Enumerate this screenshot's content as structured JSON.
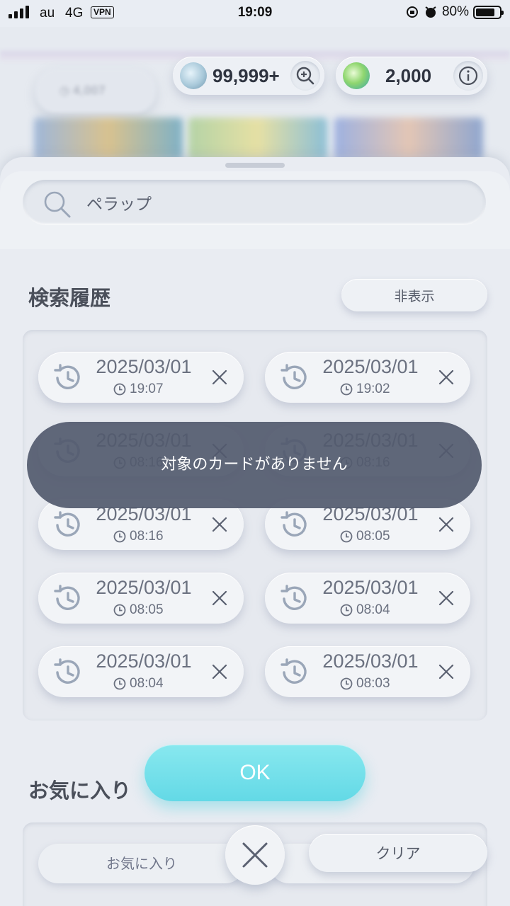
{
  "status_bar": {
    "carrier": "au",
    "network": "4G",
    "vpn": "VPN",
    "time": "19:09",
    "battery": "80%",
    "battery_level": 0.8
  },
  "currencies": {
    "primary_amount": "99,999+",
    "secondary_amount": "2,000"
  },
  "search": {
    "query": "ペラップ"
  },
  "history": {
    "title": "検索履歴",
    "hide_label": "非表示",
    "items": [
      {
        "date": "2025/03/01",
        "time": "19:07"
      },
      {
        "date": "2025/03/01",
        "time": "19:02"
      },
      {
        "date": "2025/03/01",
        "time": "08:16"
      },
      {
        "date": "2025/03/01",
        "time": "08:16"
      },
      {
        "date": "2025/03/01",
        "time": "08:16"
      },
      {
        "date": "2025/03/01",
        "time": "08:05"
      },
      {
        "date": "2025/03/01",
        "time": "08:05"
      },
      {
        "date": "2025/03/01",
        "time": "08:04"
      },
      {
        "date": "2025/03/01",
        "time": "08:04"
      },
      {
        "date": "2025/03/01",
        "time": "08:03"
      }
    ]
  },
  "favorites": {
    "title": "お気に入り",
    "chip_label": "お気に入り"
  },
  "toast": {
    "message": "対象のカードがありません"
  },
  "buttons": {
    "ok": "OK",
    "clear": "クリア"
  },
  "colors": {
    "accent": "#63d9e6",
    "toast_bg": "#525a6e",
    "panel_bg": "#e9ecf2"
  }
}
